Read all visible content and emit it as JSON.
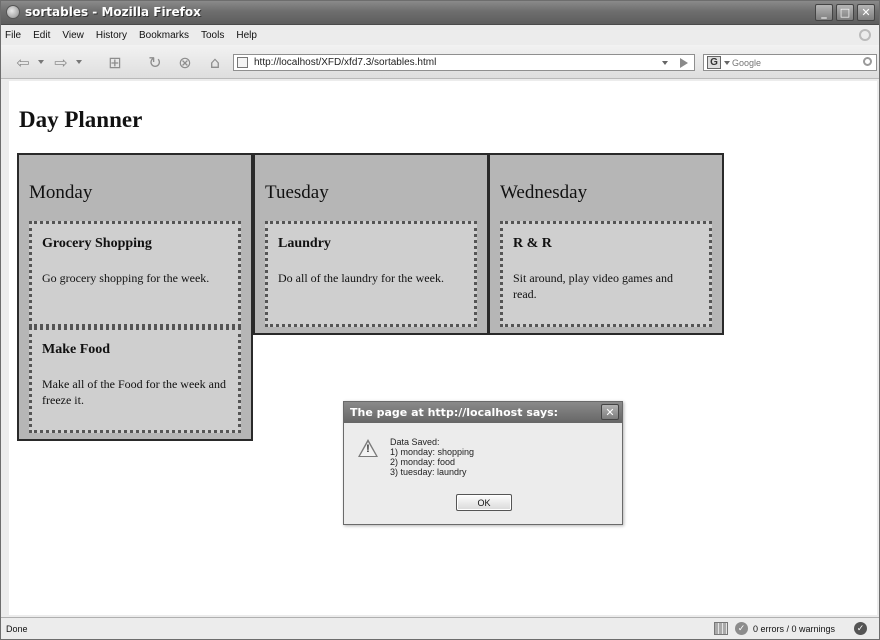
{
  "window": {
    "title": "sortables - Mozilla Firefox"
  },
  "menu": [
    "File",
    "Edit",
    "View",
    "History",
    "Bookmarks",
    "Tools",
    "Help"
  ],
  "nav": {
    "url": "http://localhost/XFD/xfd7.3/sortables.html",
    "search_placeholder": "Google",
    "search_engine_letter": "G"
  },
  "page": {
    "title": "Day Planner",
    "days": [
      {
        "name": "Monday",
        "tasks": [
          {
            "title": "Grocery Shopping",
            "desc": "Go grocery shopping for the week."
          },
          {
            "title": "Make Food",
            "desc": "Make all of the Food for the week and freeze it."
          }
        ]
      },
      {
        "name": "Tuesday",
        "tasks": [
          {
            "title": "Laundry",
            "desc": "Do all of the laundry for the week."
          }
        ]
      },
      {
        "name": "Wednesday",
        "tasks": [
          {
            "title": "R & R",
            "desc": "Sit around, play video games and read."
          }
        ]
      }
    ]
  },
  "dialog": {
    "title": "The page at http://localhost says:",
    "lines": [
      "Data Saved:",
      "1) monday: shopping",
      "2) monday: food",
      "3) tuesday: laundry"
    ],
    "ok": "OK"
  },
  "status": {
    "text": "Done",
    "errors": "0 errors / 0 warnings"
  },
  "icons": [
    "browser-logo-icon",
    "back-icon",
    "forward-icon",
    "new-tab-icon",
    "reload-icon",
    "stop-icon",
    "home-icon",
    "page-icon",
    "go-icon",
    "search-icon",
    "close-icon",
    "warning-icon",
    "check-icon"
  ]
}
